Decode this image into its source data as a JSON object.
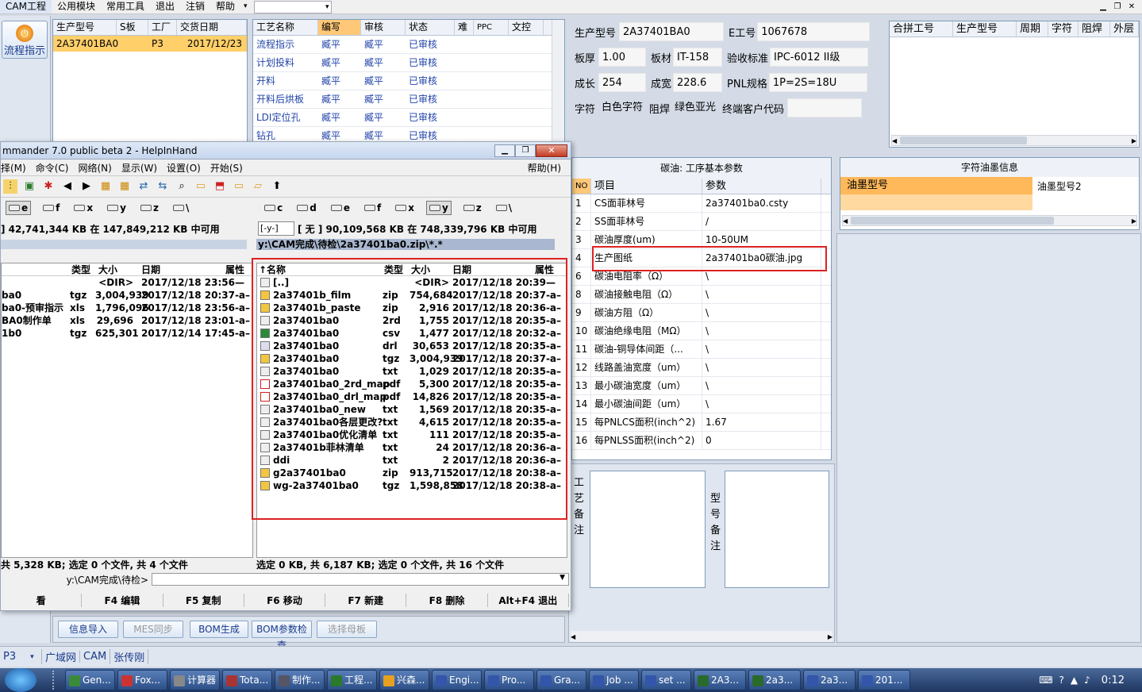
{
  "menu": {
    "items": [
      "CAM工程",
      "公用模块",
      "常用工具",
      "退出",
      "注销",
      "帮助"
    ]
  },
  "left_toolbar": {
    "flow_button": "流程指示"
  },
  "prod_grid": {
    "headers": [
      "生产型号",
      "S板",
      "工厂",
      "交货日期"
    ],
    "row": [
      "2A37401BA0",
      "",
      "P3",
      "2017/12/23"
    ]
  },
  "process_grid": {
    "headers": [
      "工艺名称",
      "编写",
      "审核",
      "状态",
      "难",
      "PPC",
      "文控"
    ],
    "rows": [
      [
        "流程指示",
        "臧平",
        "臧平",
        "已审核"
      ],
      [
        "计划投料",
        "臧平",
        "臧平",
        "已审核"
      ],
      [
        "开料",
        "臧平",
        "臧平",
        "已审核"
      ],
      [
        "开料后烘板",
        "臧平",
        "臧平",
        "已审核"
      ],
      [
        "LDI定位孔",
        "臧平",
        "臧平",
        "已审核"
      ],
      [
        "钻孔",
        "臧平",
        "臧平",
        "已审核"
      ]
    ]
  },
  "info": {
    "model_label": "生产型号",
    "model": "2A37401BA0",
    "e_label": "E工号",
    "e_value": "1067678",
    "thickness_label": "板厚",
    "thickness": "1.00",
    "material_label": "板材",
    "material": "IT-158",
    "std_label": "验收标准",
    "std": "IPC-6012 II级",
    "length_label": "成长",
    "length": "254",
    "width_label": "成宽",
    "width": "228.6",
    "pnl_label": "PNL规格",
    "pnl": "1P=2S=18U",
    "char_label": "字符",
    "char": "白色字符",
    "mask_label": "阻焊",
    "mask": "绿色亚光",
    "customer_label": "终端客户代码",
    "customer": ""
  },
  "combo_grid": {
    "headers": [
      "合拼工号",
      "生产型号",
      "周期",
      "字符",
      "阻焊",
      "外层"
    ]
  },
  "carbon": {
    "title": "碳油: 工序基本参数",
    "headers": [
      "NO",
      "项目",
      "参数"
    ],
    "rows": [
      [
        "1",
        "CS面菲林号",
        "2a37401ba0.csty"
      ],
      [
        "2",
        "SS面菲林号",
        "/"
      ],
      [
        "3",
        "碳油厚度(um)",
        "10-50UM"
      ],
      [
        "4",
        "生产图纸",
        "2a37401ba0碳油.jpg"
      ],
      [
        "6",
        "碳油电阻率（Ω）",
        "\\"
      ],
      [
        "8",
        "碳油接触电阻（Ω）",
        "\\"
      ],
      [
        "9",
        "碳油方阻（Ω）",
        "\\"
      ],
      [
        "10",
        "碳油绝缘电阻（MΩ）",
        "\\"
      ],
      [
        "11",
        "碳油-铜导体间距（...",
        "\\"
      ],
      [
        "12",
        "线路盖油宽度（um）",
        "\\"
      ],
      [
        "13",
        "最小碳油宽度（um）",
        "\\"
      ],
      [
        "14",
        "最小碳油间距（um）",
        "\\"
      ],
      [
        "15",
        "每PNLCS面积(inch^2)",
        "1.67"
      ],
      [
        "16",
        "每PNLSS面积(inch^2)",
        "0"
      ]
    ]
  },
  "ink": {
    "title": "字符油墨信息",
    "headers": [
      "油墨型号",
      "油墨型号2"
    ]
  },
  "notes": {
    "process_label": "工艺备注",
    "model_label": "型号备注"
  },
  "bottom_buttons": [
    "信息导入",
    "MES同步",
    "BOM生成",
    "BOM参数检查",
    "选择母板"
  ],
  "status_strip": {
    "plant": "P3",
    "items": [
      "广域网",
      "CAM",
      "张传刚"
    ]
  },
  "tc": {
    "title": "mmander 7.0 public beta 2 - HelpInHand",
    "menu": [
      "择(M)",
      "命令(C)",
      "网络(N)",
      "显示(W)",
      "设置(O)",
      "开始(S)"
    ],
    "help": "帮助(H)",
    "left_drives": [
      "e",
      "f",
      "x",
      "y",
      "z",
      "\\"
    ],
    "right_drives": [
      "c",
      "d",
      "e",
      "f",
      "x",
      "y",
      "z",
      "\\"
    ],
    "left_space": "] 42,741,344 KB 在 147,849,212 KB 中可用",
    "right_drive": "[-y-]",
    "right_space": "[ 无 ] 90,109,568 KB 在 748,339,796 KB 中可用",
    "right_path": "y:\\CAM完成\\待检\\2a37401ba0.zip\\*.*",
    "col_name": "↑名称",
    "col_type": "类型",
    "col_size": "大小",
    "col_date": "日期",
    "col_attr": "属性",
    "left_files": [
      [
        "",
        "",
        "<DIR>",
        "2017/12/18 23:56—"
      ],
      [
        "ba0",
        "tgz",
        "3,004,939",
        "2017/12/18 20:37-a–"
      ],
      [
        "ba0-预审指示",
        "xls",
        "1,796,096",
        "2017/12/18 23:56-a–"
      ],
      [
        "BA0制作单",
        "xls",
        "29,696",
        "2017/12/18 23:01-a–"
      ],
      [
        "1b0",
        "tgz",
        "625,301",
        "2017/12/14 17:45-a–"
      ]
    ],
    "right_files": [
      [
        "[..]",
        "",
        "<DIR>",
        "2017/12/18 20:39—"
      ],
      [
        "2a37401b_film",
        "zip",
        "754,684",
        "2017/12/18 20:37-a–"
      ],
      [
        "2a37401b_paste",
        "zip",
        "2,916",
        "2017/12/18 20:36-a–"
      ],
      [
        "2a37401ba0",
        "2rd",
        "1,755",
        "2017/12/18 20:35-a–"
      ],
      [
        "2a37401ba0",
        "csv",
        "1,477",
        "2017/12/18 20:32-a–"
      ],
      [
        "2a37401ba0",
        "drl",
        "30,653",
        "2017/12/18 20:35-a–"
      ],
      [
        "2a37401ba0",
        "tgz",
        "3,004,939",
        "2017/12/18 20:37-a–"
      ],
      [
        "2a37401ba0",
        "txt",
        "1,029",
        "2017/12/18 20:35-a–"
      ],
      [
        "2a37401ba0_2rd_map",
        "pdf",
        "5,300",
        "2017/12/18 20:35-a–"
      ],
      [
        "2a37401ba0_drl_map",
        "pdf",
        "14,826",
        "2017/12/18 20:35-a–"
      ],
      [
        "2a37401ba0_new",
        "txt",
        "1,569",
        "2017/12/18 20:35-a–"
      ],
      [
        "2a37401ba0各层更改?.",
        "txt",
        "4,615",
        "2017/12/18 20:35-a–"
      ],
      [
        "2a37401ba0优化清单",
        "txt",
        "111",
        "2017/12/18 20:35-a–"
      ],
      [
        "2a37401b菲林清单",
        "txt",
        "24",
        "2017/12/18 20:36-a–"
      ],
      [
        "ddi",
        "txt",
        "2",
        "2017/12/18 20:36-a–"
      ],
      [
        "g2a37401ba0",
        "zip",
        "913,715",
        "2017/12/18 20:38-a–"
      ],
      [
        "wg-2a37401ba0",
        "tgz",
        "1,598,858",
        "2017/12/18 20:38-a–"
      ]
    ],
    "left_status": "共 5,328 KB; 选定 0 个文件, 共 4 个文件",
    "right_status": "选定 0 KB, 共 6,187 KB; 选定 0 个文件, 共 16 个文件",
    "cmd_path": "y:\\CAM完成\\待检>",
    "fkeys": [
      "看",
      "F4 编辑",
      "F5 复制",
      "F6 移动",
      "F7 新建",
      "F8 删除",
      "Alt+F4 退出"
    ]
  },
  "taskbar": {
    "items": [
      "Gen...",
      "Fox...",
      "计算器",
      "Tota...",
      "制作...",
      "工程...",
      "兴森...",
      "Engi...",
      "Pro...",
      "Gra...",
      "Job ...",
      "set ...",
      "2A3...",
      "2a3...",
      "2a3...",
      "201..."
    ],
    "clock": "0:12"
  }
}
